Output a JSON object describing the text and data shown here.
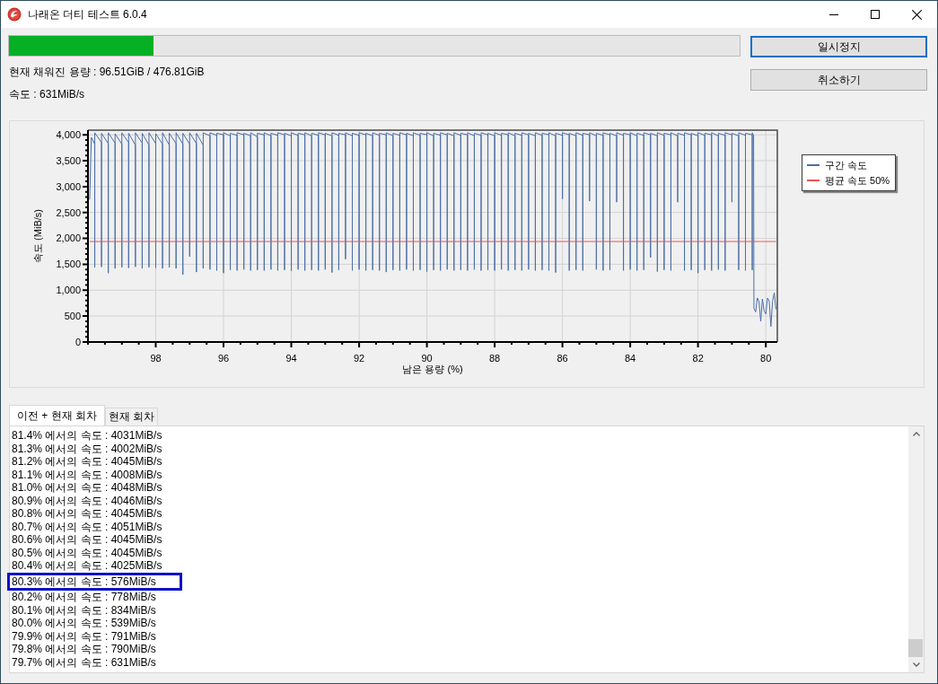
{
  "window": {
    "title": "나래온 더티 테스트 6.0.4"
  },
  "progress": {
    "level": 0.198
  },
  "info": [
    "현재 채워진 용량 : 96.51GiB / 476.81GiB",
    "속도 : 631MiB/s"
  ],
  "buttons": [
    {
      "label": "일시정지",
      "focused": true
    },
    {
      "label": "취소하기",
      "focused": false
    }
  ],
  "chart": {
    "chart_data": {
      "type": "line",
      "xlabel": "남은 용량 (%)",
      "ylabel": "속도 (MiB/s)",
      "grid": true,
      "legend": true,
      "xlim": [
        100,
        79.66
      ],
      "ylim": [
        0,
        4090
      ],
      "xticks": [
        98,
        96,
        94,
        92,
        90,
        88,
        86,
        84,
        82,
        80
      ],
      "yticks": [
        0,
        500,
        {
          "value": 1000,
          "label": "1,000"
        },
        {
          "value": 1500,
          "label": "1,500"
        },
        {
          "value": 2000,
          "label": "2,000"
        },
        {
          "value": 2500,
          "label": "2,500"
        },
        {
          "value": 3000,
          "label": "3,000"
        },
        {
          "value": 3500,
          "label": "3,500"
        },
        {
          "value": 4000,
          "label": "4,000"
        }
      ],
      "x": [
        99.95,
        99.9,
        99.8,
        99.8,
        99.8,
        99.6,
        99.6,
        99.6,
        99.4,
        99.4,
        99.4,
        99.2,
        99.2,
        99.2,
        99,
        99,
        99,
        98.8,
        98.8,
        98.8,
        98.6,
        98.6,
        98.6,
        98.4,
        98.4,
        98.4,
        98.2,
        98.2,
        98.2,
        98,
        98,
        98,
        97.8,
        97.8,
        97.8,
        97.6,
        97.6,
        97.6,
        97.4,
        97.4,
        97.4,
        97.2,
        97.2,
        97.2,
        97,
        97,
        97,
        96.8,
        96.8,
        96.8,
        96.6,
        96.6,
        96.6,
        96.4,
        96.4,
        96.4,
        96.2,
        96.2,
        96.2,
        96,
        96,
        96,
        95.8,
        95.8,
        95.8,
        95.6,
        95.6,
        95.6,
        95.4,
        95.4,
        95.4,
        95.2,
        95.2,
        95.2,
        95,
        95,
        95,
        94.8,
        94.8,
        94.8,
        94.6,
        94.6,
        94.6,
        94.4,
        94.4,
        94.4,
        94.2,
        94.2,
        94.2,
        94,
        94,
        94,
        93.8,
        93.8,
        93.8,
        93.6,
        93.6,
        93.6,
        93.4,
        93.4,
        93.4,
        93.2,
        93.2,
        93.2,
        93,
        93,
        93,
        92.8,
        92.8,
        92.8,
        92.6,
        92.6,
        92.6,
        92.4,
        92.4,
        92.4,
        92.2,
        92.2,
        92.2,
        92,
        92,
        92,
        91.8,
        91.8,
        91.8,
        91.6,
        91.6,
        91.6,
        91.4,
        91.4,
        91.4,
        91.2,
        91.2,
        91.2,
        91,
        91,
        91,
        90.8,
        90.8,
        90.8,
        90.6,
        90.6,
        90.6,
        90.4,
        90.4,
        90.4,
        90.2,
        90.2,
        90.2,
        90,
        90,
        90,
        89.8,
        89.8,
        89.8,
        89.6,
        89.6,
        89.6,
        89.4,
        89.4,
        89.4,
        89.2,
        89.2,
        89.2,
        89,
        89,
        89,
        88.8,
        88.8,
        88.8,
        88.6,
        88.6,
        88.6,
        88.4,
        88.4,
        88.4,
        88.2,
        88.2,
        88.2,
        88,
        88,
        88,
        87.8,
        87.8,
        87.8,
        87.6,
        87.6,
        87.6,
        87.4,
        87.4,
        87.4,
        87.2,
        87.2,
        87.2,
        87,
        87,
        87,
        86.8,
        86.8,
        86.8,
        86.6,
        86.6,
        86.6,
        86.4,
        86.4,
        86.4,
        86.2,
        86.2,
        86.2,
        86,
        86,
        86,
        85.8,
        85.8,
        85.8,
        85.6,
        85.6,
        85.6,
        85.4,
        85.4,
        85.4,
        85.2,
        85.2,
        85.2,
        85,
        85,
        85,
        84.8,
        84.8,
        84.8,
        84.6,
        84.6,
        84.6,
        84.4,
        84.4,
        84.4,
        84.2,
        84.2,
        84.2,
        84,
        84,
        84,
        83.8,
        83.8,
        83.8,
        83.6,
        83.6,
        83.6,
        83.4,
        83.4,
        83.4,
        83.2,
        83.2,
        83.2,
        83,
        83,
        83,
        82.8,
        82.8,
        82.8,
        82.6,
        82.6,
        82.6,
        82.4,
        82.4,
        82.4,
        82.2,
        82.2,
        82.2,
        82,
        82,
        82,
        81.8,
        81.8,
        81.8,
        81.6,
        81.6,
        81.6,
        81.4,
        81.4,
        81.4,
        81.2,
        81.2,
        81.2,
        81,
        81,
        81,
        80.8,
        80.8,
        80.8,
        80.6,
        80.6,
        80.6,
        80.4,
        80.4,
        80.4,
        80.36,
        80.35,
        80.3,
        80.25,
        80.2,
        80.15,
        80.1,
        80.05,
        80,
        79.95,
        79.9,
        79.85,
        79.8,
        79.75,
        79.7
      ],
      "series": [
        {
          "name": "구간 속도",
          "color": "#4a6ea8",
          "values": [
            2750,
            3950,
            3820,
            1440,
            4040,
            3850,
            1450,
            4030,
            3830,
            1330,
            4040,
            3840,
            1420,
            4020,
            3820,
            1440,
            4040,
            3850,
            1430,
            4030,
            3800,
            1450,
            4040,
            3840,
            1420,
            4030,
            3800,
            1440,
            4040,
            3830,
            1430,
            4020,
            3820,
            1420,
            4040,
            3800,
            1440,
            4030,
            3830,
            1420,
            4040,
            3820,
            1300,
            4030,
            3820,
            1650,
            4040,
            3830,
            1350,
            4030,
            3800,
            1420,
            4040,
            3980,
            1400,
            4040,
            3990,
            1380,
            4030,
            4000,
            1330,
            4040,
            3980,
            1390,
            4030,
            3990,
            1380,
            4040,
            4000,
            1400,
            4030,
            3980,
            1380,
            4040,
            3960,
            1390,
            4030,
            4000,
            1380,
            4040,
            3980,
            1400,
            4030,
            3990,
            1380,
            4040,
            4000,
            1390,
            4030,
            3980,
            1370,
            4040,
            3990,
            1400,
            4030,
            4000,
            1380,
            4040,
            3980,
            1390,
            4030,
            3990,
            1380,
            4040,
            4000,
            1400,
            4030,
            3980,
            1340,
            4040,
            3990,
            1390,
            4030,
            4000,
            1600,
            4040,
            3980,
            1380,
            4030,
            3990,
            1400,
            4040,
            4000,
            1380,
            4030,
            3980,
            1390,
            4040,
            3990,
            1380,
            4030,
            4000,
            1350,
            4040,
            3980,
            1390,
            4030,
            3990,
            1380,
            4040,
            4000,
            1400,
            4030,
            3980,
            1380,
            4040,
            3990,
            1390,
            4030,
            4000,
            1360,
            4040,
            3980,
            1390,
            4030,
            3990,
            1380,
            4040,
            4000,
            1400,
            4030,
            3980,
            1380,
            4040,
            3990,
            1390,
            4030,
            4000,
            1380,
            4040,
            3980,
            1400,
            4030,
            3990,
            1380,
            4040,
            4000,
            1390,
            4030,
            3980,
            1380,
            4040,
            3990,
            1400,
            4030,
            4000,
            1380,
            4040,
            3980,
            1390,
            4030,
            3990,
            1380,
            4040,
            4000,
            1400,
            4030,
            3980,
            1380,
            4040,
            3990,
            1390,
            4030,
            4000,
            1380,
            4040,
            3980,
            1340,
            4030,
            3990,
            2760,
            4040,
            4000,
            1380,
            4030,
            3980,
            1390,
            4040,
            3990,
            1380,
            4030,
            4000,
            2720,
            4040,
            3980,
            1400,
            4030,
            3990,
            1380,
            4040,
            4000,
            1390,
            4030,
            3980,
            2700,
            4040,
            3990,
            1380,
            4030,
            4000,
            1400,
            4040,
            3980,
            1380,
            4030,
            3990,
            1390,
            4040,
            4000,
            1630,
            4030,
            3980,
            1360,
            4040,
            3990,
            1390,
            4030,
            4000,
            1380,
            4040,
            3980,
            2700,
            4030,
            3990,
            1380,
            4040,
            4000,
            1390,
            4030,
            3980,
            1330,
            4040,
            3990,
            1390,
            4030,
            4000,
            1380,
            4040,
            3980,
            1400,
            4030,
            3990,
            1380,
            4040,
            4000,
            2700,
            4030,
            3980,
            1390,
            4040,
            3990,
            1380,
            4030,
            4000,
            1390,
            4040,
            3990,
            650,
            580,
            850,
            780,
            400,
            830,
            600,
            540,
            850,
            790,
            300,
            790,
            950,
            630
          ]
        },
        {
          "name": "평균 속도 50%",
          "color": "#e85555",
          "values": [
            1940,
            1940,
            1940,
            1940,
            1940,
            1940,
            1940,
            1940,
            1940,
            1940,
            1940,
            1940,
            1940,
            1940,
            1940,
            1940,
            1940,
            1940,
            1940,
            1940,
            1940,
            1940,
            1940,
            1940,
            1940,
            1940,
            1940,
            1940,
            1940,
            1940,
            1940,
            1940,
            1940,
            1940,
            1940,
            1940,
            1940,
            1940,
            1940,
            1940,
            1940,
            1940,
            1940,
            1940,
            1940,
            1940,
            1940,
            1940,
            1940,
            1940,
            1940,
            1940,
            1940,
            1940,
            1940,
            1940,
            1940,
            1940,
            1940,
            1940,
            1940,
            1940,
            1940,
            1940,
            1940,
            1940,
            1940,
            1940,
            1940,
            1940,
            1940,
            1940,
            1940,
            1940,
            1940,
            1940,
            1940,
            1940,
            1940,
            1940,
            1940,
            1940,
            1940,
            1940,
            1940,
            1940,
            1940,
            1940,
            1940,
            1940,
            1940,
            1940,
            1940,
            1940,
            1940,
            1940,
            1940,
            1940,
            1940,
            1940,
            1940,
            1940,
            1940,
            1940,
            1940,
            1940,
            1940,
            1940,
            1940,
            1940,
            1940,
            1940,
            1940,
            1940,
            1940,
            1940,
            1940,
            1940,
            1940,
            1940,
            1940,
            1940,
            1940,
            1940,
            1940,
            1940,
            1940,
            1940,
            1940,
            1940,
            1940,
            1940,
            1940,
            1940,
            1940,
            1940,
            1940,
            1940,
            1940,
            1940,
            1940,
            1940,
            1940,
            1940,
            1940,
            1940,
            1940,
            1940,
            1940,
            1940,
            1940,
            1940,
            1940,
            1940,
            1940,
            1940,
            1940,
            1940,
            1940,
            1940,
            1940,
            1940,
            1940,
            1940,
            1940,
            1940,
            1940,
            1940,
            1940,
            1940,
            1940,
            1940,
            1940,
            1940,
            1940,
            1940,
            1940,
            1940,
            1940,
            1940,
            1940,
            1940,
            1940,
            1940,
            1940,
            1940,
            1940,
            1940,
            1940,
            1940,
            1940,
            1940,
            1940,
            1940,
            1940,
            1940,
            1940,
            1940,
            1940,
            1940,
            1940,
            1940,
            1940,
            1940,
            1940,
            1940,
            1940,
            1940,
            1940,
            1940,
            1940,
            1940,
            1940,
            1940,
            1940,
            1940,
            1940,
            1940,
            1940,
            1940,
            1940,
            1940,
            1940,
            1940,
            1940,
            1940,
            1940,
            1940,
            1940,
            1940,
            1940,
            1940,
            1940,
            1940,
            1940,
            1940,
            1940,
            1940,
            1940,
            1940,
            1940,
            1940,
            1940,
            1940,
            1940,
            1940,
            1940,
            1940,
            1940,
            1940,
            1940,
            1940,
            1940,
            1940,
            1940,
            1940,
            1940,
            1940,
            1940,
            1940,
            1940,
            1940,
            1940,
            1940,
            1940,
            1940,
            1940,
            1940,
            1940,
            1940,
            1940,
            1940,
            1940,
            1940,
            1940,
            1940,
            1940,
            1940,
            1940,
            1940,
            1940,
            1940,
            1940,
            1940,
            1940,
            1940,
            1940,
            1940,
            1940,
            1940,
            1940,
            1940,
            1940,
            1940,
            1940,
            1940,
            1940,
            1940,
            1940,
            1940,
            1940,
            1940,
            1940,
            1940,
            1940,
            1940,
            1940,
            1940,
            1940,
            1940,
            1940
          ]
        }
      ]
    }
  },
  "tabs": [
    {
      "label": "이전 + 현재 회차",
      "selected": true
    },
    {
      "label": "현재 회차",
      "selected": false
    }
  ],
  "log": {
    "rows": [
      {
        "text": "81.4% 에서의 속도 : 4031MiB/s",
        "highlighted": false
      },
      {
        "text": "81.3% 에서의 속도 : 4002MiB/s",
        "highlighted": false
      },
      {
        "text": "81.2% 에서의 속도 : 4045MiB/s",
        "highlighted": false
      },
      {
        "text": "81.1% 에서의 속도 : 4008MiB/s",
        "highlighted": false
      },
      {
        "text": "81.0% 에서의 속도 : 4048MiB/s",
        "highlighted": false
      },
      {
        "text": "80.9% 에서의 속도 : 4046MiB/s",
        "highlighted": false
      },
      {
        "text": "80.8% 에서의 속도 : 4045MiB/s",
        "highlighted": false
      },
      {
        "text": "80.7% 에서의 속도 : 4051MiB/s",
        "highlighted": false
      },
      {
        "text": "80.6% 에서의 속도 : 4045MiB/s",
        "highlighted": false
      },
      {
        "text": "80.5% 에서의 속도 : 4045MiB/s",
        "highlighted": false
      },
      {
        "text": "80.4% 에서의 속도 : 4025MiB/s",
        "highlighted": false
      },
      {
        "text": "80.3% 에서의 속도 : 576MiB/s",
        "highlighted": true
      },
      {
        "text": "80.2% 에서의 속도 : 778MiB/s",
        "highlighted": false
      },
      {
        "text": "80.1% 에서의 속도 : 834MiB/s",
        "highlighted": false
      },
      {
        "text": "80.0% 에서의 속도 : 539MiB/s",
        "highlighted": false
      },
      {
        "text": "79.9% 에서의 속도 : 791MiB/s",
        "highlighted": false
      },
      {
        "text": "79.8% 에서의 속도 : 790MiB/s",
        "highlighted": false
      },
      {
        "text": "79.7% 에서의 속도 : 631MiB/s",
        "highlighted": false
      }
    ]
  }
}
